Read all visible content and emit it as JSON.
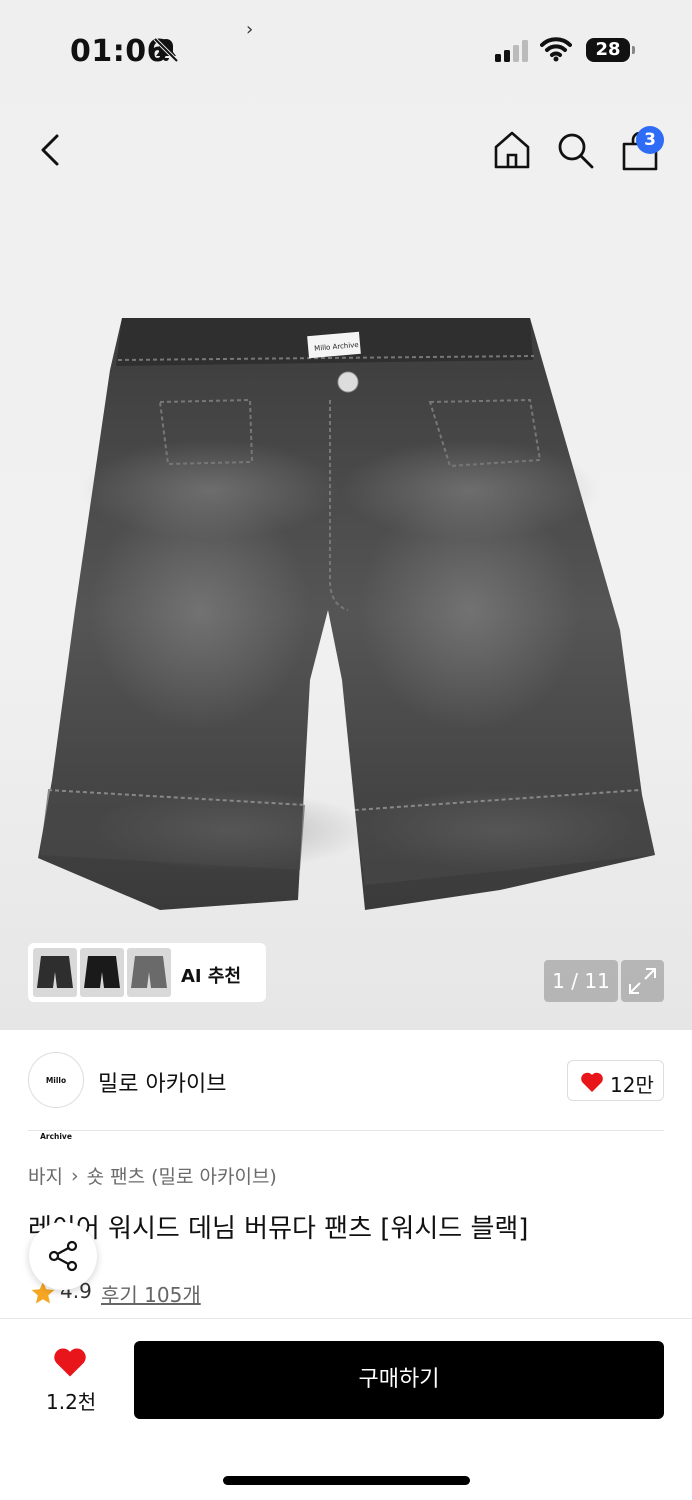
{
  "status_bar": {
    "time": "01:06",
    "battery": "28",
    "icons": [
      "bell-slash-icon",
      "cellular-signal-icon",
      "wifi-icon",
      "battery-icon"
    ]
  },
  "nav": {
    "icons": [
      "chevron-left-icon",
      "home-icon",
      "search-icon",
      "shopping-bag-icon"
    ],
    "cart_badge": "3",
    "badge_color": "#2e6cf6"
  },
  "gallery": {
    "label_tag": "Millo Archive",
    "ai_recommend_label": "AI 추천",
    "ai_chevron": "›",
    "counter": "1 / 11"
  },
  "brand": {
    "logo_text": "Millo Archive",
    "name": "밀로 아카이브",
    "like_count": "12만",
    "like_color": "#e8151b"
  },
  "product": {
    "breadcrumb": [
      "바지",
      "숏 팬츠 (밀로 아카이브)"
    ],
    "breadcrumb_sep": "›",
    "title": "레이어 워시드 데님 버뮤다 팬츠 [워시드 블랙]",
    "rating": "4.9",
    "review_label": "후기 105개",
    "star_color": "#f5a623"
  },
  "bottom_bar": {
    "wish_count": "1.2천",
    "buy_label": "구매하기"
  }
}
